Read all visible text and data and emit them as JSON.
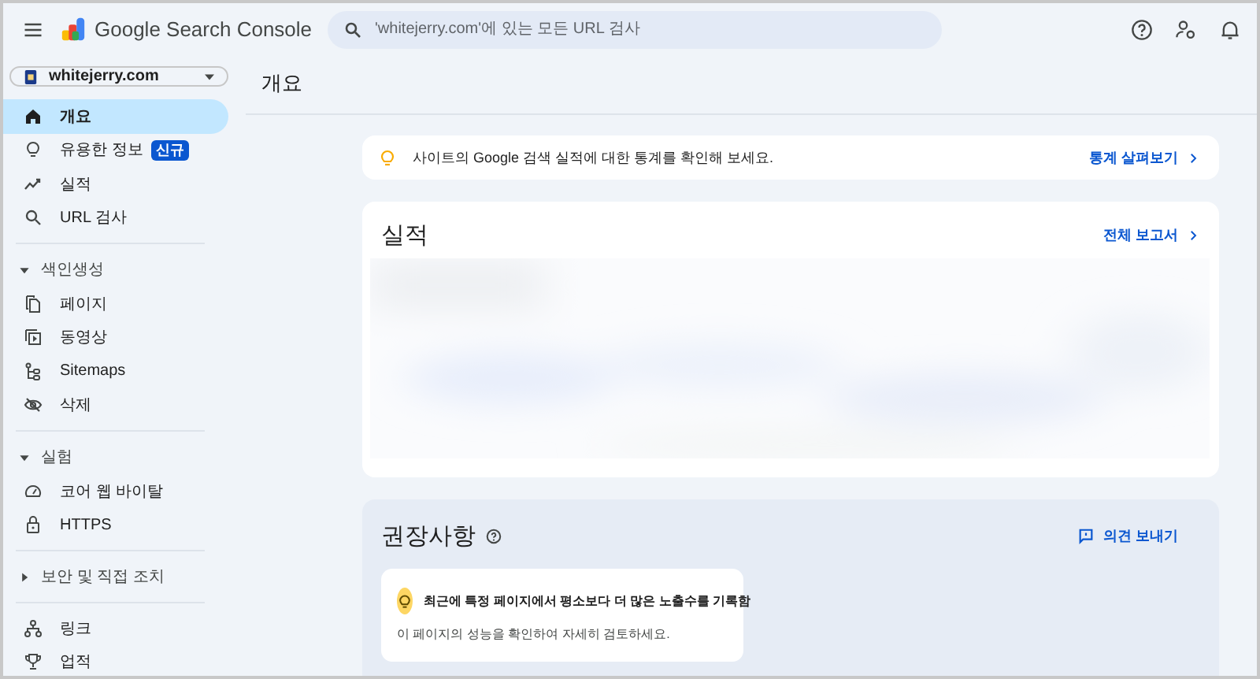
{
  "app": {
    "title": "Google Search Console"
  },
  "search": {
    "placeholder": "'whitejerry.com'에 있는 모든 URL 검사"
  },
  "property": {
    "name": "whitejerry.com"
  },
  "nav_groups": [
    {
      "items": [
        {
          "label": "개요",
          "selected": true
        },
        {
          "label": "유용한 정보",
          "badge": "신규",
          "selected": false
        },
        {
          "label": "실적",
          "selected": false
        },
        {
          "label": "URL 검사",
          "selected": false
        }
      ]
    },
    {
      "label": "색인생성",
      "expanded": true,
      "items": [
        {
          "label": "페이지",
          "selected": false
        },
        {
          "label": "동영상",
          "selected": false
        },
        {
          "label": "Sitemaps",
          "selected": false
        },
        {
          "label": "삭제",
          "selected": false
        }
      ]
    },
    {
      "label": "실험",
      "expanded": true,
      "items": [
        {
          "label": "코어 웹 바이탈",
          "selected": false
        },
        {
          "label": "HTTPS",
          "selected": false
        }
      ]
    },
    {
      "label": "보안 및 직접 조치",
      "expanded": false
    },
    {
      "items": [
        {
          "label": "링크",
          "selected": false
        },
        {
          "label": "업적",
          "selected": false
        }
      ]
    }
  ],
  "page_title": "개요",
  "tip": {
    "text": "사이트의 Google 검색 실적에 대한 통계를 확인해 보세요.",
    "link": "통계 살펴보기"
  },
  "performance": {
    "title": "실적",
    "link": "전체 보고서"
  },
  "recommendations": {
    "title": "권장사항",
    "feedback": "의견 보내기",
    "cards": [
      {
        "title": "최근에 특정 페이지에서 평소보다 더 많은 노출수를 기록함",
        "text": "이 페이지의 성능을 확인하여 자세히 검토하세요."
      }
    ]
  }
}
